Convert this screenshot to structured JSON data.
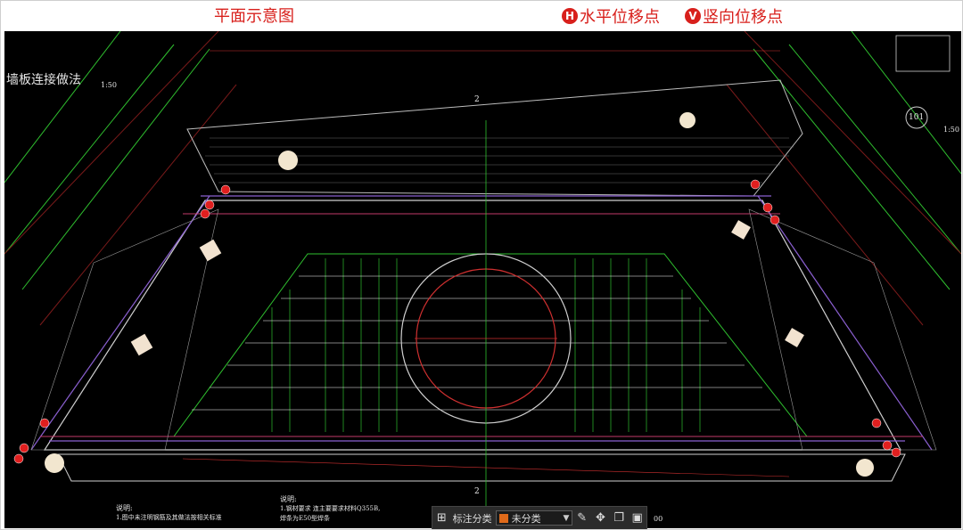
{
  "header": {
    "title": "平面示意图",
    "legend": [
      {
        "badge": "H",
        "label": "水平位移点",
        "color": "#d8201c"
      },
      {
        "badge": "V",
        "label": "竖向位移点",
        "color": "#d8201c"
      }
    ]
  },
  "drawing": {
    "title_text": "墙板连接做法",
    "scale_left": "1:50",
    "scale_right": "1:50",
    "detail_mark": "101",
    "section_mark": "2",
    "notes_left_heading": "说明:",
    "notes_left_line": "1.图中未注明钢筋及其做法按相关标准",
    "notes_mid_heading": "说明:",
    "notes_mid_line1": "1.钢材要求    连主要要求材料Q355B,",
    "notes_mid_line2": "   焊条为E50型焊条",
    "corner_num": "00"
  },
  "toolbar": {
    "group_label": "标注分类",
    "select_value": "未分类",
    "swatch_color": "#e06a1a",
    "buttons": [
      "grid-icon",
      "edit-icon",
      "move-icon",
      "copy-icon",
      "paste-icon"
    ]
  }
}
